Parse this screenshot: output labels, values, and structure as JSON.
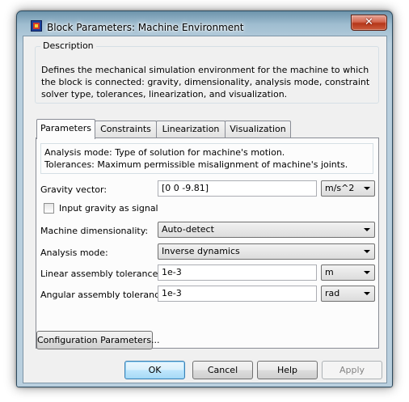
{
  "window": {
    "title": "Block Parameters: Machine Environment",
    "close_label": "✕"
  },
  "description": {
    "legend": "Description",
    "text": "Defines the mechanical simulation environment for the machine to which the block is connected: gravity, dimensionality, analysis mode, constraint solver type, tolerances, linearization, and visualization."
  },
  "tabs": [
    {
      "label": "Parameters",
      "active": true
    },
    {
      "label": "Constraints",
      "active": false
    },
    {
      "label": "Linearization",
      "active": false
    },
    {
      "label": "Visualization",
      "active": false
    }
  ],
  "parameters": {
    "help_line1": "Analysis mode: Type of solution for machine's motion.",
    "help_line2": "Tolerances: Maximum permissible misalignment of machine's joints.",
    "gravity_label": "Gravity vector:",
    "gravity_value": "[0 0 -9.81]",
    "gravity_unit": "m/s^2",
    "input_gravity_label": "Input gravity as signal",
    "input_gravity_checked": false,
    "dimensionality_label": "Machine dimensionality:",
    "dimensionality_value": "Auto-detect",
    "analysis_label": "Analysis mode:",
    "analysis_value": "Inverse dynamics",
    "linear_tol_label": "Linear assembly tolerance:",
    "linear_tol_value": "1e-3",
    "linear_tol_unit": "m",
    "angular_tol_label": "Angular assembly tolerance:",
    "angular_tol_value": "1e-3",
    "angular_tol_unit": "rad"
  },
  "buttons": {
    "config": "Configuration Parameters...",
    "ok": "OK",
    "cancel": "Cancel",
    "help": "Help",
    "apply": "Apply"
  },
  "colors": {
    "default_button_border": "#3c7fb1",
    "close_button": "#c8462a"
  }
}
